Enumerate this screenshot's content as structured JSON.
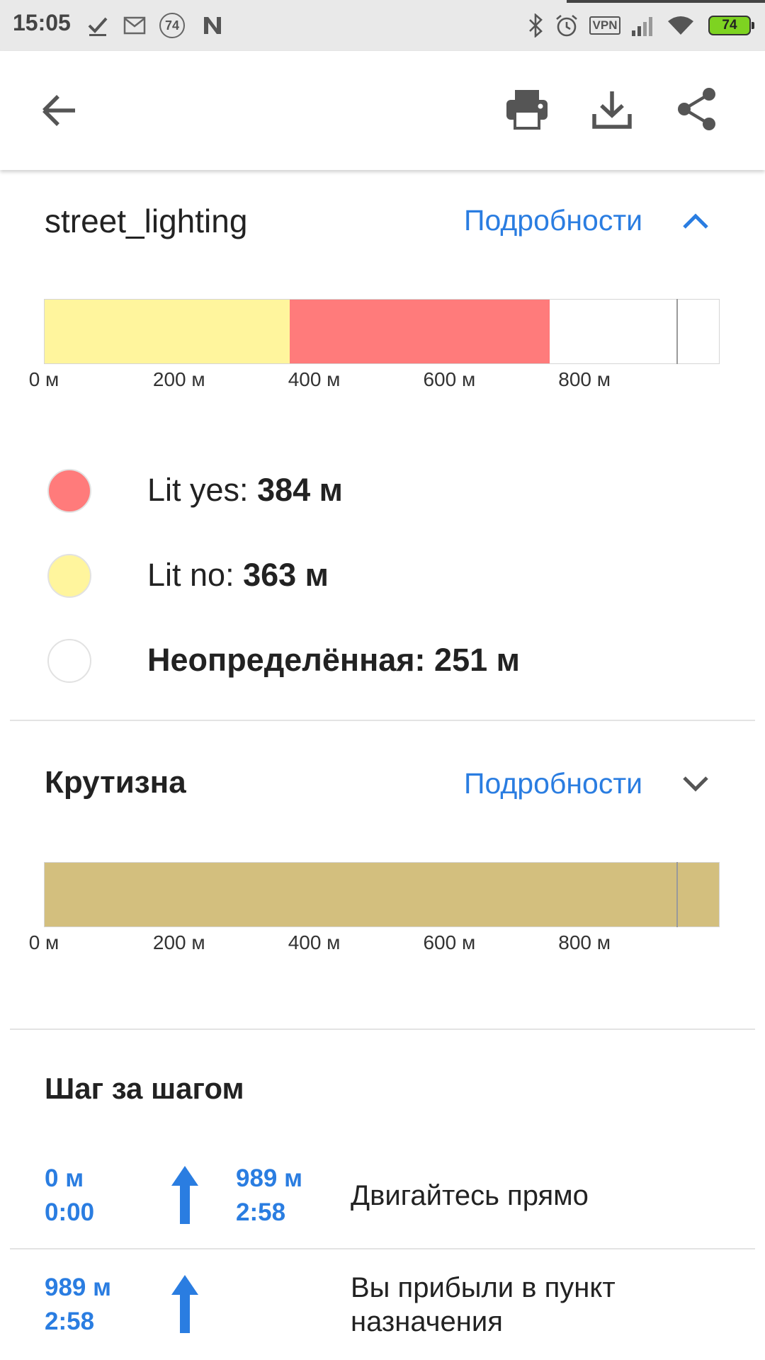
{
  "status_bar": {
    "time": "15:05",
    "notification_badge": "74",
    "vpn_label": "VPN",
    "battery": "74",
    "icons": [
      "check-icon",
      "mail-icon",
      "badge-74-icon",
      "n-logo-icon",
      "bluetooth-icon",
      "alarm-icon",
      "vpn-icon",
      "signal-icon",
      "wifi-icon",
      "battery-icon"
    ]
  },
  "toolbar": {
    "back_icon": "arrow-left-icon",
    "actions": [
      "print-icon",
      "download-icon",
      "share-icon"
    ]
  },
  "lighting": {
    "title": "street_lighting",
    "details_label": "Подробности",
    "expanded": true,
    "chart_data": {
      "type": "bar",
      "orientation": "horizontal-stacked",
      "total_m": 998,
      "segments": [
        {
          "name": "Lit no",
          "value": 363,
          "color": "#fff59d"
        },
        {
          "name": "Lit yes",
          "value": 384,
          "color": "#ff7b7b"
        },
        {
          "name": "Неопределённая",
          "value": 251,
          "color": "#ffffff"
        }
      ],
      "marker_at_m": 935,
      "xlim": [
        0,
        998
      ],
      "ticks": [
        "0 м",
        "200 м",
        "400 м",
        "600 м",
        "800 м"
      ]
    },
    "legend": [
      {
        "label": "Lit yes: ",
        "value": "384 м",
        "color": "#ff7b7b"
      },
      {
        "label": "Lit no: ",
        "value": "363 м",
        "color": "#fff59d"
      },
      {
        "label": "",
        "value": "Неопределённая: 251 м",
        "color": "#ffffff"
      }
    ]
  },
  "steepness": {
    "title": "Крутизна",
    "details_label": "Подробности",
    "expanded": false,
    "chart_data": {
      "type": "bar",
      "orientation": "horizontal-stacked",
      "total_m": 998,
      "segments": [
        {
          "name": "",
          "value": 998,
          "color": "#d3bf7e"
        }
      ],
      "marker_at_m": 935,
      "xlim": [
        0,
        998
      ],
      "ticks": [
        "0 м",
        "200 м",
        "400 м",
        "600 м",
        "800 м"
      ]
    }
  },
  "steps": {
    "title": "Шаг за шагом",
    "items": [
      {
        "start_dist": "0 м",
        "start_time": "0:00",
        "icon": "arrow-up-icon",
        "end_dist": "989 м",
        "end_time": "2:58",
        "text": "Двигайтесь прямо"
      },
      {
        "start_dist": "989 м",
        "start_time": "2:58",
        "icon": "arrow-up-icon",
        "end_dist": "",
        "end_time": "",
        "text": "Вы прибыли в пункт назначения"
      }
    ]
  }
}
